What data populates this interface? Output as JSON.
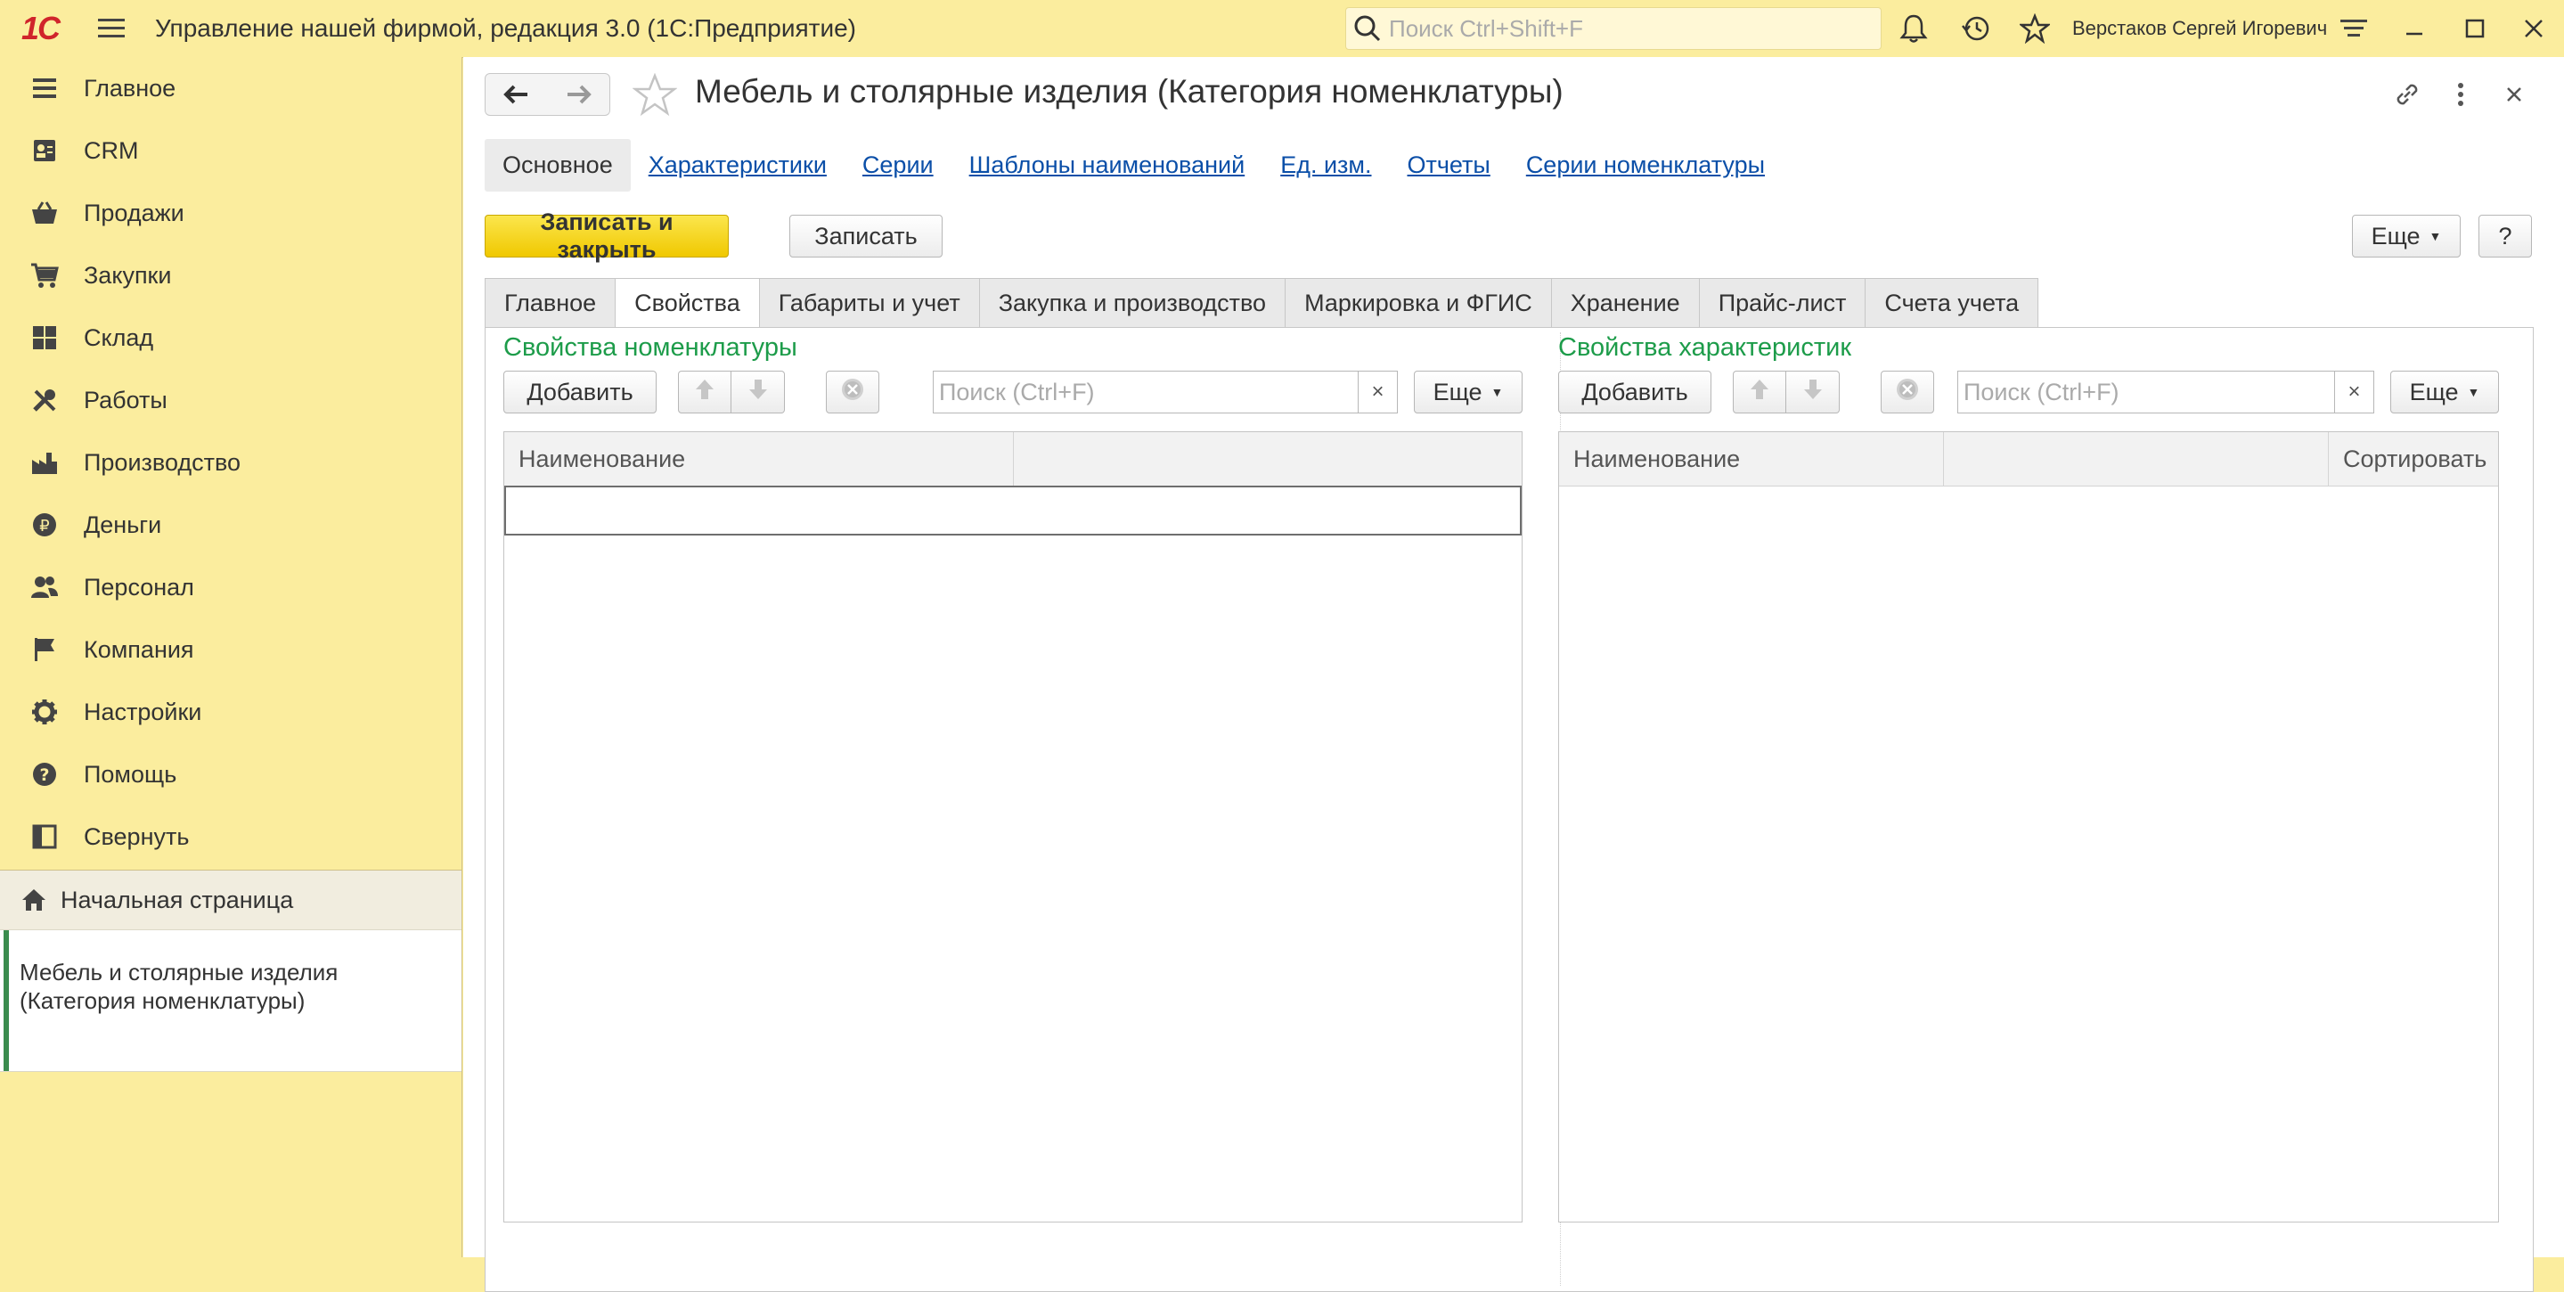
{
  "titlebar": {
    "logo": "1С",
    "app_title": "Управление нашей фирмой, редакция 3.0  (1С:Предприятие)",
    "search_placeholder": "Поиск Ctrl+Shift+F",
    "user_name": "Верстаков Сергей Игоревич"
  },
  "sidebar": {
    "items": [
      {
        "label": "Главное",
        "icon": "list-icon"
      },
      {
        "label": "CRM",
        "icon": "contacts-icon"
      },
      {
        "label": "Продажи",
        "icon": "basket-icon"
      },
      {
        "label": "Закупки",
        "icon": "cart-icon"
      },
      {
        "label": "Склад",
        "icon": "warehouse-icon"
      },
      {
        "label": "Работы",
        "icon": "tools-icon"
      },
      {
        "label": "Производство",
        "icon": "factory-icon"
      },
      {
        "label": "Деньги",
        "icon": "ruble-icon"
      },
      {
        "label": "Персонал",
        "icon": "people-icon"
      },
      {
        "label": "Компания",
        "icon": "flag-icon"
      },
      {
        "label": "Настройки",
        "icon": "gear-icon"
      },
      {
        "label": "Помощь",
        "icon": "help-icon"
      },
      {
        "label": "Свернуть",
        "icon": "collapse-icon"
      }
    ],
    "home_label": "Начальная страница",
    "open_doc_line1": "Мебель и столярные изделия",
    "open_doc_line2": "(Категория номенклатуры)"
  },
  "form": {
    "title": "Мебель и столярные изделия (Категория номенклатуры)",
    "links": [
      "Основное",
      "Характеристики",
      "Серии",
      "Шаблоны наименований",
      "Ед. изм.",
      "Отчеты",
      "Серии номенклатуры"
    ],
    "save_close_label": "Записать и закрыть",
    "save_label": "Записать",
    "more_label": "Еще",
    "help_label": "?",
    "tabs": [
      "Главное",
      "Свойства",
      "Габариты и учет",
      "Закупка и производство",
      "Маркировка и ФГИС",
      "Хранение",
      "Прайс-лист",
      "Счета учета"
    ],
    "active_tab": "Свойства"
  },
  "left_panel": {
    "title": "Свойства номенклатуры",
    "add_label": "Добавить",
    "search_placeholder": "Поиск (Ctrl+F)",
    "clear_label": "×",
    "more_label": "Еще",
    "columns": [
      "Наименование",
      ""
    ]
  },
  "right_panel": {
    "title": "Свойства характеристик",
    "add_label": "Добавить",
    "search_placeholder": "Поиск (Ctrl+F)",
    "clear_label": "×",
    "more_label": "Еще",
    "columns": [
      "Наименование",
      "",
      "Сортировать"
    ]
  },
  "colors": {
    "accent_yellow": "#fbed9e",
    "primary_button": "#f5d412",
    "panel_title_green": "#1d9c4a",
    "link_blue": "#0b4fa8",
    "logo_red": "#d0242b"
  }
}
